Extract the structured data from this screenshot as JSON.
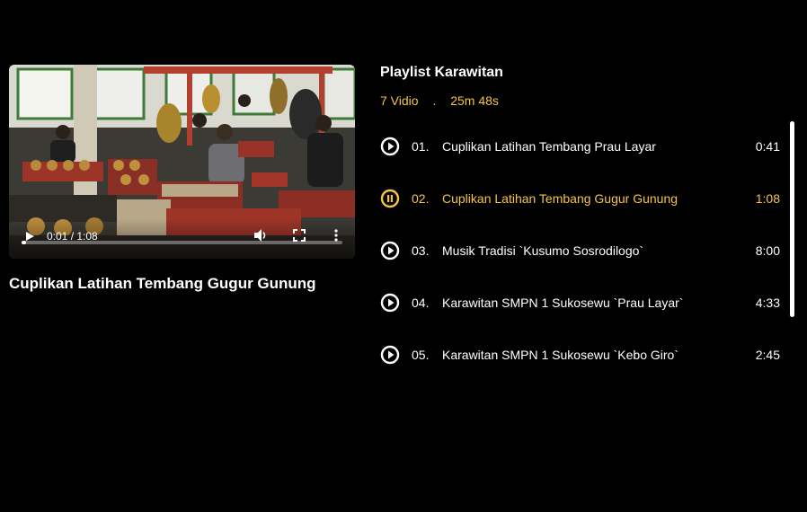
{
  "player": {
    "time_display": "0:01 / 1:08",
    "progress": 0.015,
    "now_playing_title": "Cuplikan Latihan Tembang Gugur Gunung"
  },
  "playlist": {
    "title": "Playlist Karawitan",
    "count_label": "7 Vidio",
    "separator": ".",
    "total_duration": "25m 48s",
    "items": [
      {
        "num": "01.",
        "title": "Cuplikan Latihan Tembang Prau Layar",
        "duration": "0:41",
        "state": "play"
      },
      {
        "num": "02.",
        "title": "Cuplikan Latihan Tembang Gugur Gunung",
        "duration": "1:08",
        "state": "pause"
      },
      {
        "num": "03.",
        "title": "Musik Tradisi `Kusumo Sosrodilogo`",
        "duration": "8:00",
        "state": "play"
      },
      {
        "num": "04.",
        "title": "Karawitan SMPN 1 Sukosewu `Prau Layar`",
        "duration": "4:33",
        "state": "play"
      },
      {
        "num": "05.",
        "title": "Karawitan SMPN 1 Sukosewu `Kebo Giro`",
        "duration": "2:45",
        "state": "play"
      }
    ]
  },
  "colors": {
    "accent": "#f5c542",
    "background": "#000000",
    "text": "#ffffff"
  },
  "icons": {
    "play": "play-circle-icon",
    "pause": "pause-circle-icon"
  }
}
